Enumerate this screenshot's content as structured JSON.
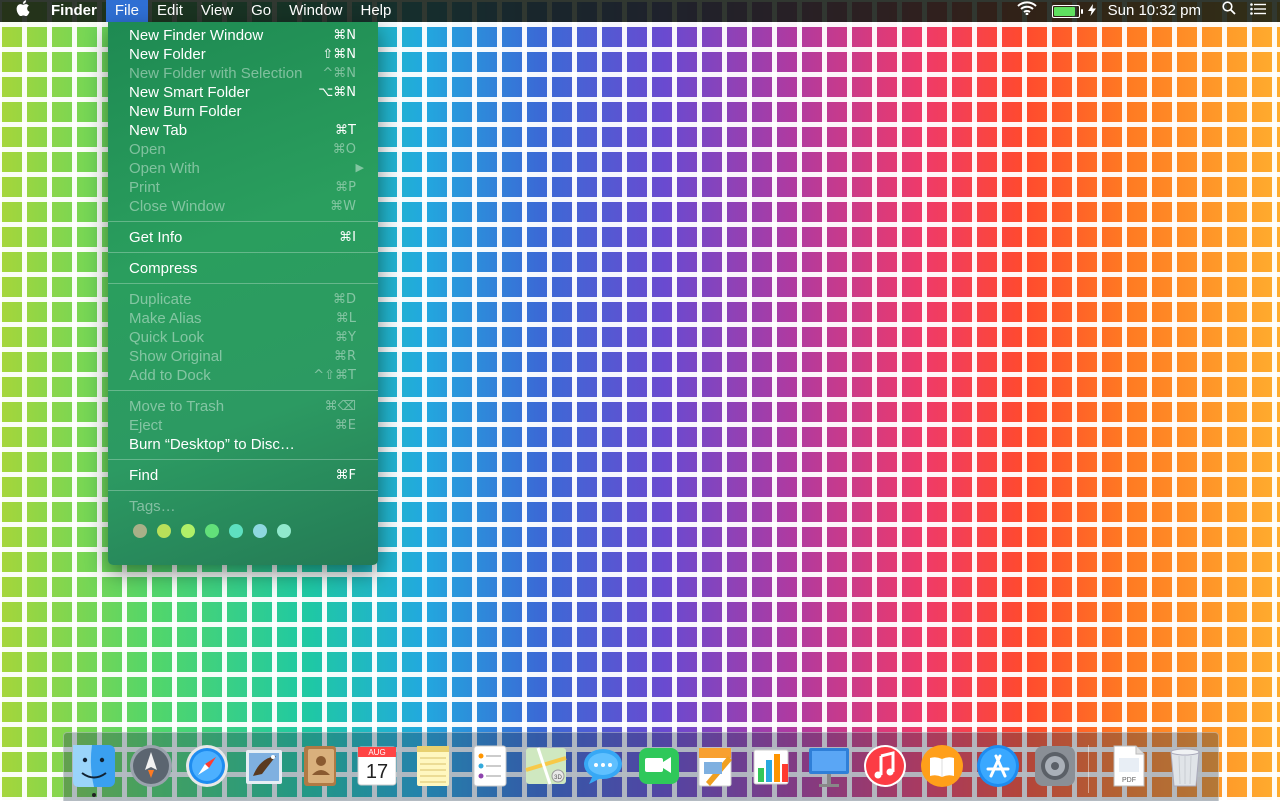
{
  "menubar": {
    "apple_icon": "apple-logo",
    "app_name": "Finder",
    "menus": [
      "File",
      "Edit",
      "View",
      "Go",
      "Window",
      "Help"
    ],
    "active_menu": "File",
    "status": {
      "wifi_icon": "wifi-icon",
      "battery_level": 0.9,
      "charging_icon": "bolt-icon",
      "clock": "Sun 10:32 pm",
      "search_icon": "spotlight-icon",
      "notification_icon": "notification-center-icon"
    }
  },
  "file_menu": {
    "groups": [
      [
        {
          "label": "New Finder Window",
          "shortcut": "⌘N",
          "enabled": true
        },
        {
          "label": "New Folder",
          "shortcut": "⇧⌘N",
          "enabled": true
        },
        {
          "label": "New Folder with Selection",
          "shortcut": "^⌘N",
          "enabled": false
        },
        {
          "label": "New Smart Folder",
          "shortcut": "⌥⌘N",
          "enabled": true
        },
        {
          "label": "New Burn Folder",
          "shortcut": "",
          "enabled": true
        },
        {
          "label": "New Tab",
          "shortcut": "⌘T",
          "enabled": true
        },
        {
          "label": "Open",
          "shortcut": "⌘O",
          "enabled": false
        },
        {
          "label": "Open With",
          "shortcut": "",
          "enabled": false,
          "submenu": true
        },
        {
          "label": "Print",
          "shortcut": "⌘P",
          "enabled": false
        },
        {
          "label": "Close Window",
          "shortcut": "⌘W",
          "enabled": false
        }
      ],
      [
        {
          "label": "Get Info",
          "shortcut": "⌘I",
          "enabled": true
        }
      ],
      [
        {
          "label": "Compress",
          "shortcut": "",
          "enabled": true
        }
      ],
      [
        {
          "label": "Duplicate",
          "shortcut": "⌘D",
          "enabled": false
        },
        {
          "label": "Make Alias",
          "shortcut": "⌘L",
          "enabled": false
        },
        {
          "label": "Quick Look",
          "shortcut": "⌘Y",
          "enabled": false
        },
        {
          "label": "Show Original",
          "shortcut": "⌘R",
          "enabled": false
        },
        {
          "label": "Add to Dock",
          "shortcut": "^⇧⌘T",
          "enabled": false
        }
      ],
      [
        {
          "label": "Move to Trash",
          "shortcut": "⌘⌫",
          "enabled": false
        },
        {
          "label": "Eject",
          "shortcut": "⌘E",
          "enabled": false
        },
        {
          "label": "Burn “Desktop” to Disc…",
          "shortcut": "",
          "enabled": true
        }
      ],
      [
        {
          "label": "Find",
          "shortcut": "⌘F",
          "enabled": true
        }
      ],
      [
        {
          "label": "Tags…",
          "shortcut": "",
          "enabled": false
        }
      ]
    ],
    "tag_colors": [
      "#a8b088",
      "#b8e05a",
      "#b0f068",
      "#62e07a",
      "#5ee0c0",
      "#8ed8e0",
      "#90e8cc"
    ]
  },
  "dock": {
    "apps": [
      {
        "name": "finder-icon",
        "running": true
      },
      {
        "name": "launchpad-icon",
        "running": false
      },
      {
        "name": "safari-icon",
        "running": false
      },
      {
        "name": "mail-icon",
        "running": false
      },
      {
        "name": "contacts-icon",
        "running": false
      },
      {
        "name": "calendar-icon",
        "running": false,
        "month": "AUG",
        "day": "17"
      },
      {
        "name": "notes-icon",
        "running": false
      },
      {
        "name": "reminders-icon",
        "running": false
      },
      {
        "name": "maps-icon",
        "running": false
      },
      {
        "name": "messages-icon",
        "running": false
      },
      {
        "name": "facetime-icon",
        "running": false
      },
      {
        "name": "pages-icon",
        "running": false
      },
      {
        "name": "numbers-icon",
        "running": false
      },
      {
        "name": "keynote-icon",
        "running": false
      },
      {
        "name": "itunes-icon",
        "running": false
      },
      {
        "name": "ibooks-icon",
        "running": false
      },
      {
        "name": "app-store-icon",
        "running": false
      },
      {
        "name": "system-preferences-icon",
        "running": false
      }
    ],
    "stack": [
      {
        "name": "pdf-document-icon",
        "label": "PDF"
      },
      {
        "name": "trash-icon"
      }
    ]
  }
}
